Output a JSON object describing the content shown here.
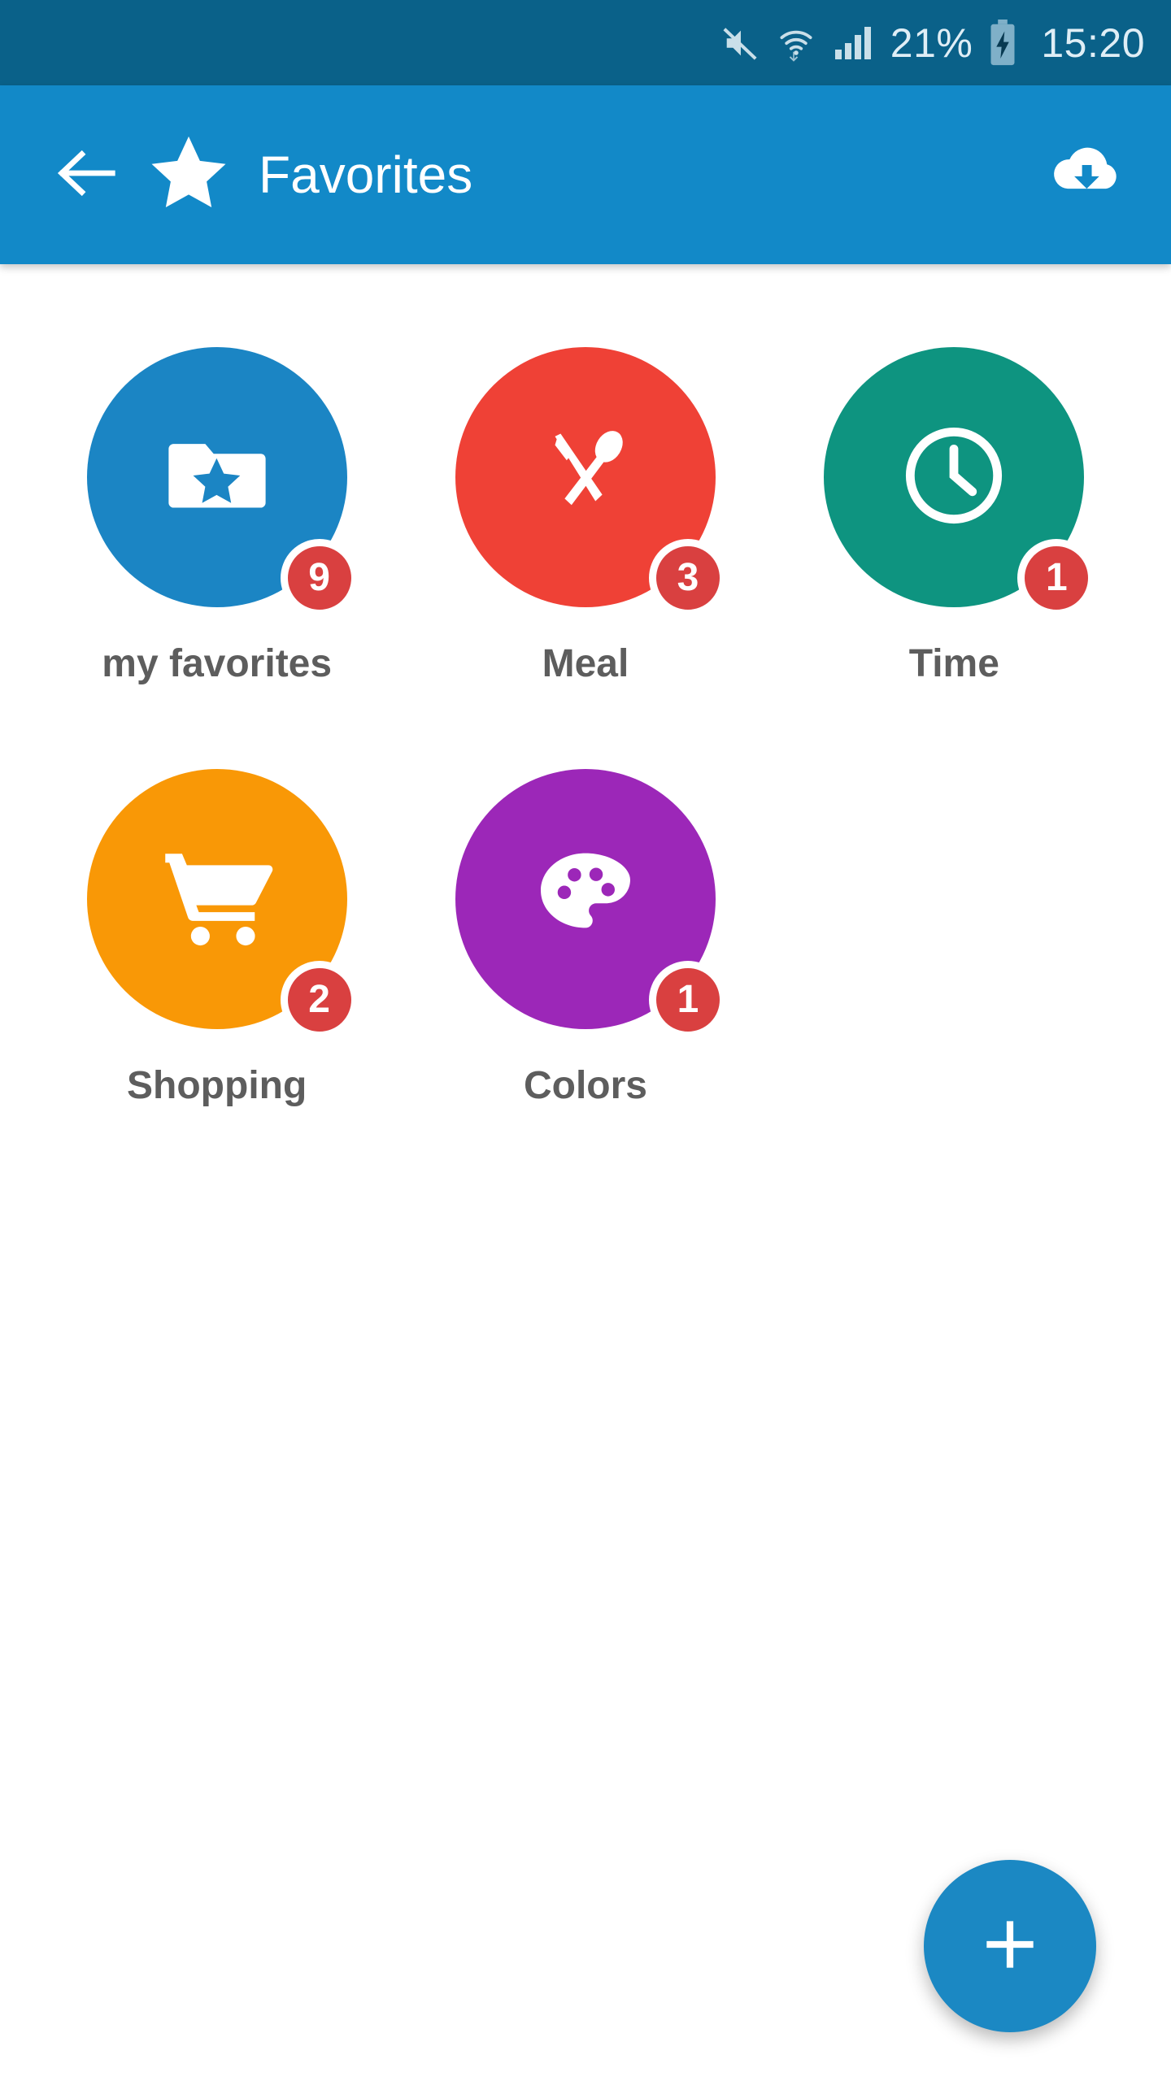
{
  "status_bar": {
    "background": "#0a6189",
    "mute_icon": "mute-icon",
    "wifi_icon": "wifi-data-icon",
    "signal_icon": "cellular-signal-icon",
    "battery_percent": "21%",
    "battery_icon": "battery-charging-icon",
    "time": "15:20"
  },
  "app_bar": {
    "background": "#1289c8",
    "back_icon": "back-arrow-icon",
    "star_icon": "star-icon",
    "title": "Favorites",
    "action_icon": "cloud-download-icon"
  },
  "categories": [
    {
      "label": "my favorites",
      "badge": "9",
      "color": "#1b85c4",
      "icon": "folder-star-icon"
    },
    {
      "label": "Meal",
      "badge": "3",
      "color": "#ef4136",
      "icon": "cutlery-icon"
    },
    {
      "label": "Time",
      "badge": "1",
      "color": "#0e9480",
      "icon": "clock-icon"
    },
    {
      "label": "Shopping",
      "badge": "2",
      "color": "#f99806",
      "icon": "shopping-cart-icon"
    },
    {
      "label": "Colors",
      "badge": "1",
      "color": "#9c27b8",
      "icon": "palette-icon"
    }
  ],
  "badge_color": "#d94040",
  "fab": {
    "label": "+",
    "icon": "plus-icon",
    "color": "#1b88c3"
  }
}
